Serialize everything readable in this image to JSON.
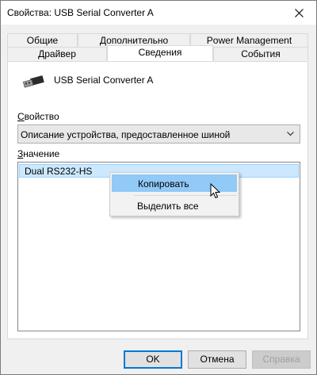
{
  "window": {
    "title": "Свойства: USB Serial Converter A"
  },
  "tabs": {
    "back_row": [
      "Общие",
      "Дополнительно",
      "Power Management"
    ],
    "front_row": [
      "Драйвер",
      "Сведения",
      "События"
    ],
    "active": "Сведения"
  },
  "device": {
    "name": "USB Serial Converter A",
    "icon": "usb-plug-icon"
  },
  "property": {
    "label_prefix": "",
    "label_underline": "С",
    "label_rest": "войство",
    "selected": "Описание устройства, предоставленное шиной"
  },
  "value": {
    "label_underline": "З",
    "label_rest": "начение",
    "items": [
      "Dual RS232-HS"
    ]
  },
  "context_menu": {
    "items": [
      "Копировать",
      "Выделить все"
    ],
    "hovered": "Копировать"
  },
  "buttons": {
    "ok": "OK",
    "cancel": "Отмена",
    "apply": "Справка"
  },
  "colors": {
    "selection": "#cce8ff",
    "menu_hover": "#91c9f7",
    "default_button": "#0078d7"
  }
}
